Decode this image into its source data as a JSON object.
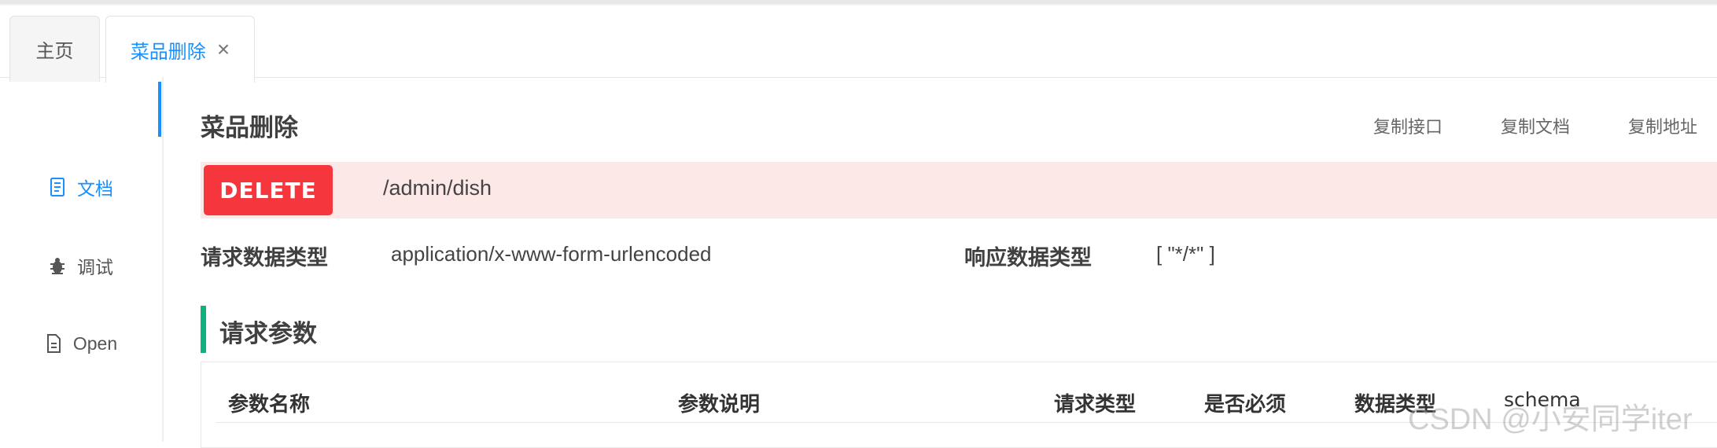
{
  "tabs": [
    {
      "label": "主页"
    },
    {
      "label": "菜品删除",
      "close": "×"
    }
  ],
  "side_nav": {
    "items": [
      {
        "label": "文档",
        "icon": "document-icon"
      },
      {
        "label": "调试",
        "icon": "bug-icon"
      },
      {
        "label": "Open",
        "icon": "file-icon"
      }
    ]
  },
  "api": {
    "title": "菜品删除",
    "copy_actions": [
      "复制接口",
      "复制文档",
      "复制地址"
    ],
    "method": "DELETE",
    "path": "/admin/dish",
    "request_type_label": "请求数据类型",
    "request_type_value": "application/x-www-form-urlencoded",
    "response_type_label": "响应数据类型",
    "response_type_value": "[ \"*/*\" ]"
  },
  "request_params": {
    "section_title": "请求参数",
    "columns": [
      "参数名称",
      "参数说明",
      "请求类型",
      "是否必须",
      "数据类型",
      "schema"
    ]
  },
  "watermark": "CSDN @小安同学iter",
  "colors": {
    "accent": "#1890ff",
    "delete_badge": "#f5373d",
    "delete_row": "#fde8e8",
    "section_bar": "#0fb27f"
  }
}
